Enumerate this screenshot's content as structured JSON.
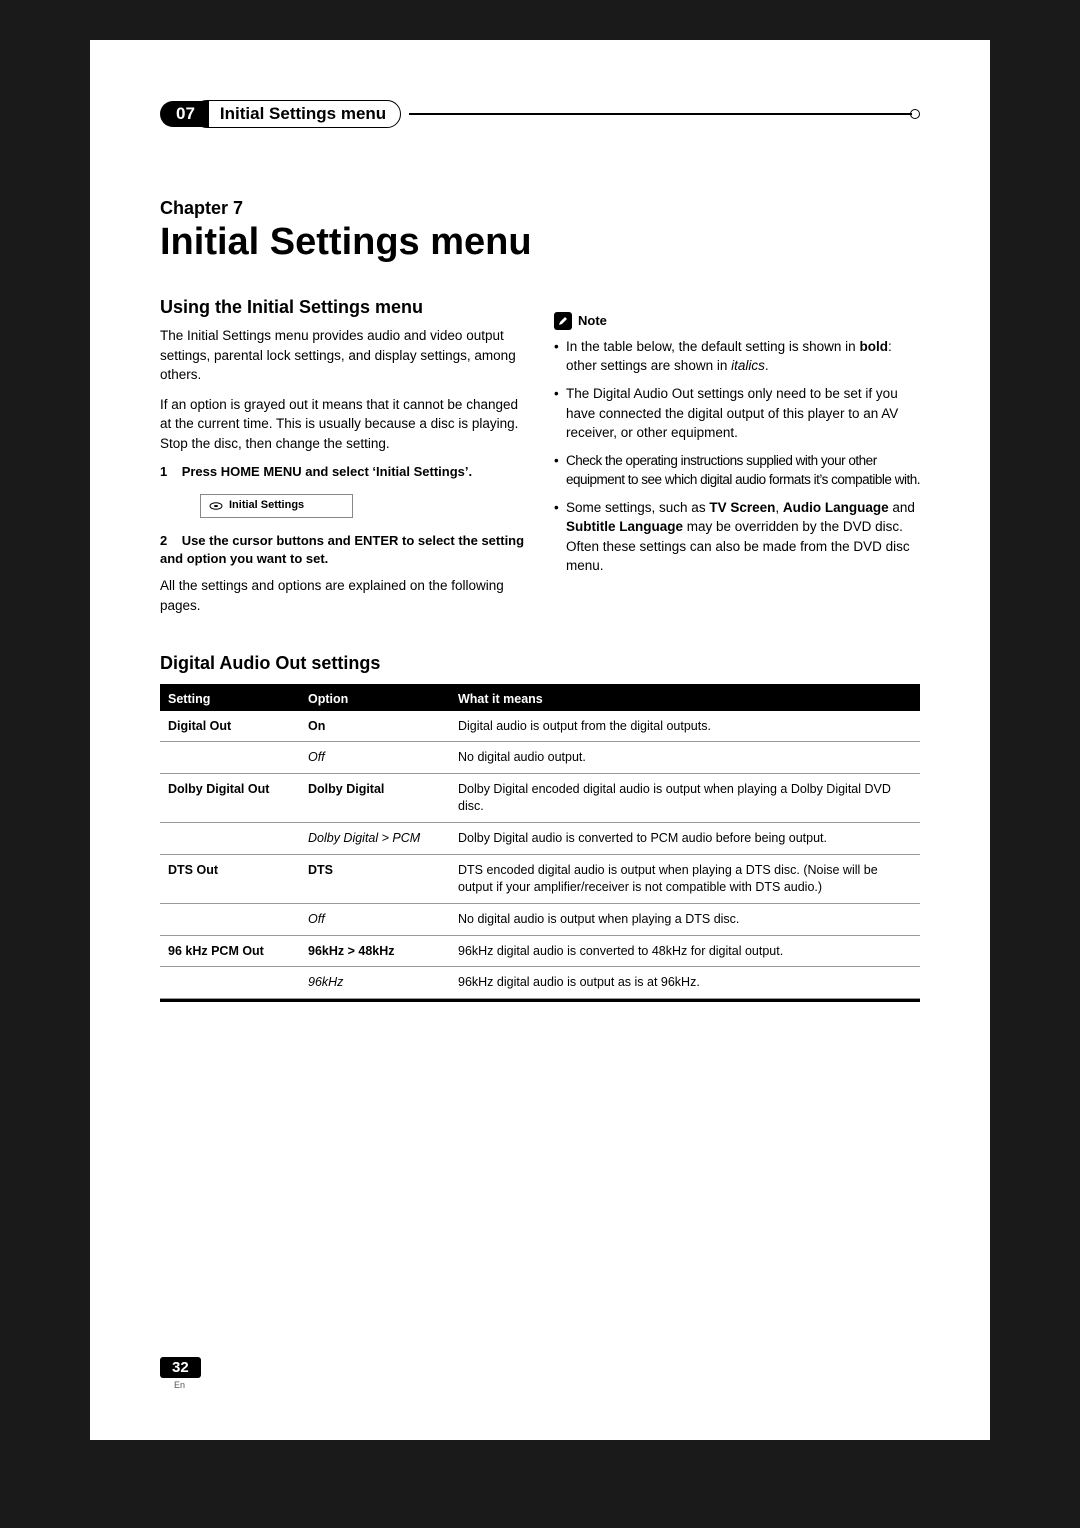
{
  "header": {
    "chapter_num": "07",
    "chapter_title": "Initial Settings menu"
  },
  "chapter": {
    "label": "Chapter 7",
    "heading": "Initial Settings menu"
  },
  "left": {
    "heading": "Using the Initial Settings menu",
    "p1": "The Initial Settings menu provides audio and video output settings, parental lock settings, and display settings, among others.",
    "p2": "If an option is grayed out it means that it cannot be changed at the current time. This is usually because a disc is playing. Stop the disc, then change the setting.",
    "step1_num": "1",
    "step1": "Press HOME MENU and select ‘Initial Settings’.",
    "menu_item": "Initial Settings",
    "step2_num": "2",
    "step2": "Use the cursor buttons and ENTER to select the setting and option you want to set.",
    "p3": "All the settings and options are explained on the following pages."
  },
  "right": {
    "note_label": "Note",
    "n1_a": "In the table below, the default setting is shown in ",
    "n1_b": "bold",
    "n1_c": ": other settings are shown in ",
    "n1_d": "italics",
    "n1_e": ".",
    "n2": "The Digital Audio Out settings only need to be set if you have connected the digital output of this player to an AV receiver, or other equipment.",
    "n3": "Check the operating instructions supplied with your other equipment to see which digital audio formats it’s compatible with.",
    "n4_a": "Some settings, such as ",
    "n4_b": "TV Screen",
    "n4_c": ", ",
    "n4_d": "Audio Language",
    "n4_e": " and ",
    "n4_f": "Subtitle Language",
    "n4_g": " may be overridden by the DVD disc. Often these settings can also be made from the DVD disc menu."
  },
  "table": {
    "heading": "Digital Audio Out settings",
    "col1": "Setting",
    "col2": "Option",
    "col3": "What it means",
    "rows": [
      {
        "setting": "Digital Out",
        "option": "On",
        "style": "bold",
        "desc": "Digital audio is output from the digital outputs."
      },
      {
        "setting": "",
        "option": "Off",
        "style": "ital",
        "desc": "No digital audio output."
      },
      {
        "setting": "Dolby Digital Out",
        "option": "Dolby Digital",
        "style": "bold",
        "desc": "Dolby Digital encoded digital audio is output when playing a Dolby Digital DVD disc."
      },
      {
        "setting": "",
        "option": "Dolby Digital > PCM",
        "style": "ital",
        "desc": "Dolby Digital audio is converted to PCM audio before being output."
      },
      {
        "setting": "DTS Out",
        "option": "DTS",
        "style": "bold",
        "desc": "DTS encoded digital audio is output when playing a DTS disc. (Noise will be output if your amplifier/receiver is not compatible with DTS audio.)"
      },
      {
        "setting": "",
        "option": "Off",
        "style": "ital",
        "desc": "No digital audio is output when playing a DTS disc."
      },
      {
        "setting": "96 kHz PCM Out",
        "option": "96kHz > 48kHz",
        "style": "bold",
        "desc": "96kHz digital audio is converted to 48kHz for digital output."
      },
      {
        "setting": "",
        "option": "96kHz",
        "style": "ital",
        "desc": "96kHz digital audio is output as is at 96kHz."
      }
    ]
  },
  "footer": {
    "page": "32",
    "lang": "En"
  }
}
